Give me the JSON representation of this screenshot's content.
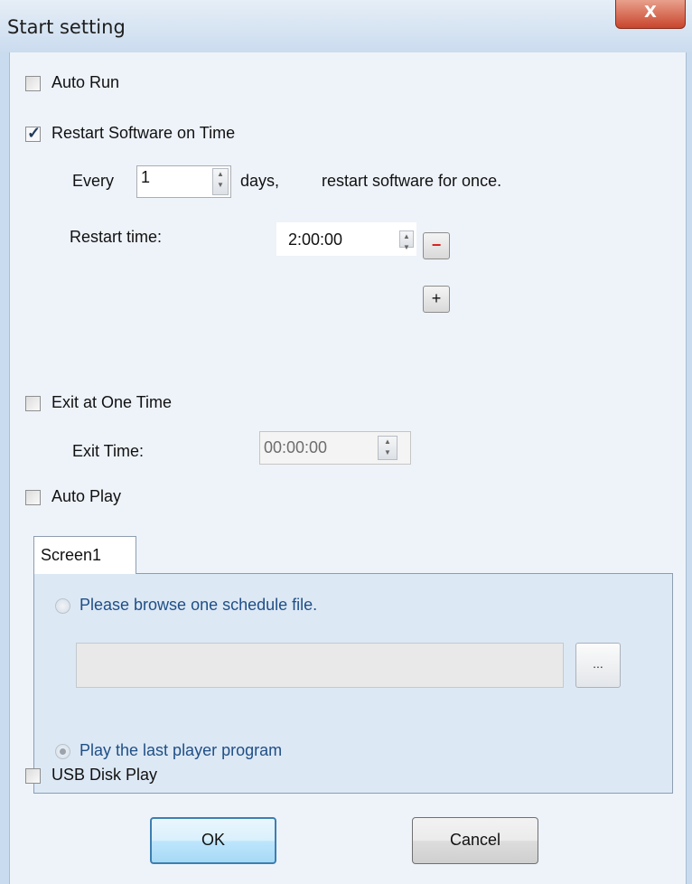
{
  "window": {
    "title": "Start setting",
    "close_label": "X"
  },
  "auto_run": {
    "label": "Auto Run",
    "checked": false
  },
  "restart_on_time": {
    "label": "Restart Software on Time",
    "checked": true,
    "every_label": "Every",
    "days_value": "1",
    "days_label": "days,",
    "suffix_label": "restart software for once.",
    "restart_time_label": "Restart time:",
    "restart_time_value": "2:00:00",
    "remove_label": "−",
    "add_label": "+"
  },
  "exit_at_time": {
    "label": "Exit at One Time",
    "checked": false,
    "exit_time_label": "Exit Time:",
    "exit_time_value": "00:00:00"
  },
  "auto_play": {
    "label": "Auto Play",
    "checked": false,
    "tabs": [
      "Screen1"
    ],
    "browse_option": "Please browse one schedule file.",
    "file_path": "",
    "browse_button": "...",
    "last_program_option": "Play the last player program",
    "selected_option": "last_program"
  },
  "usb_disk_play": {
    "label": "USB Disk Play",
    "checked": false
  },
  "buttons": {
    "ok": "OK",
    "cancel": "Cancel"
  },
  "colors": {
    "title_bar": "#cbdcef",
    "client_bg": "#eef3fa",
    "option_text": "#1f4f85",
    "close_button": "#c8452c"
  }
}
